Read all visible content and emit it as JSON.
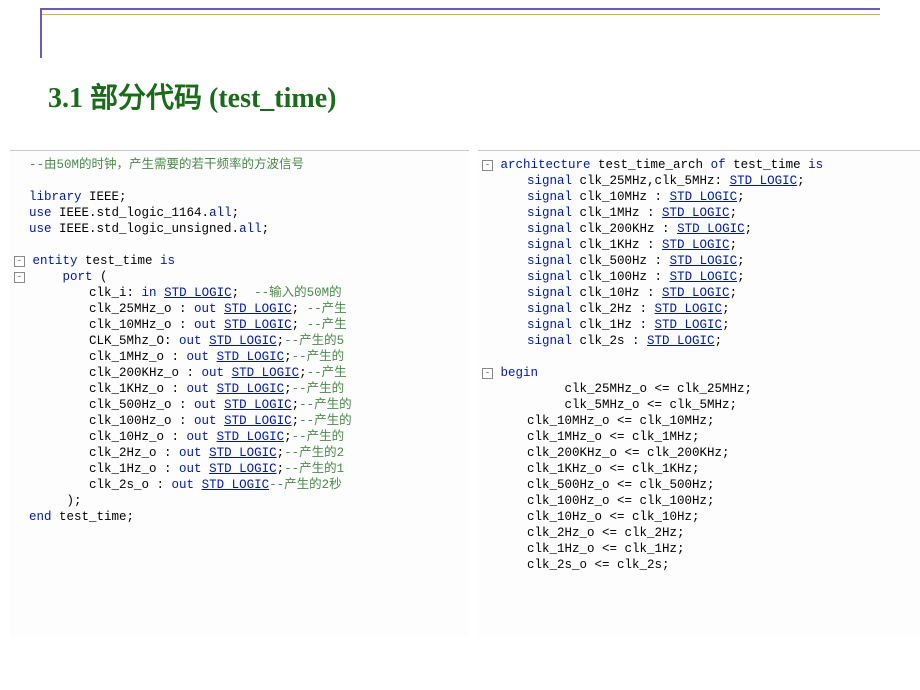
{
  "title": "3.1 部分代码  (test_time)",
  "left": {
    "l1": "--由50M的时钟，产生需要的若干频率的方波信号",
    "l2": "library",
    "l2b": " IEEE;",
    "l3": "use",
    "l3b": " IEEE.std_logic_1164.",
    "l3c": "all",
    "l3d": ";",
    "l4": "use",
    "l4b": " IEEE.std_logic_unsigned.",
    "l4c": "all",
    "l4d": ";",
    "l5a": "entity",
    "l5b": " test_time ",
    "l5c": "is",
    "l6a": "port",
    "l6b": " (",
    "p1a": "clk_i: ",
    "p1b": "in",
    "p1c": " ",
    "p1t": "STD_LOGIC",
    "p1e": ";  ",
    "p1cm": "--输入的50M的",
    "p2a": "clk_25MHz_o : ",
    "p2b": "out",
    "p2c": " ",
    "p2t": "STD_LOGIC",
    "p2e": "; ",
    "p2cm": "--产生",
    "p3a": "clk_10MHz_o : ",
    "p3b": "out",
    "p3c": " ",
    "p3t": "STD_LOGIC",
    "p3e": "; ",
    "p3cm": "--产生",
    "p4a": "CLK_5Mhz_O: ",
    "p4b": "out",
    "p4c": " ",
    "p4t": "STD_LOGIC",
    "p4e": ";",
    "p4cm": "--产生的5",
    "p5a": "clk_1MHz_o : ",
    "p5b": "out",
    "p5c": " ",
    "p5t": "STD_LOGIC",
    "p5e": ";",
    "p5cm": "--产生的",
    "p6a": "clk_200KHz_o : ",
    "p6b": "out",
    "p6c": " ",
    "p6t": "STD_LOGIC",
    "p6e": ";",
    "p6cm": "--产生",
    "p7a": "clk_1KHz_o : ",
    "p7b": "out",
    "p7c": " ",
    "p7t": "STD_LOGIC",
    "p7e": ";",
    "p7cm": "--产生的",
    "p8a": "clk_500Hz_o : ",
    "p8b": "out",
    "p8c": " ",
    "p8t": "STD_LOGIC",
    "p8e": ";",
    "p8cm": "--产生的",
    "p9a": "clk_100Hz_o : ",
    "p9b": "out",
    "p9c": " ",
    "p9t": "STD_LOGIC",
    "p9e": ";",
    "p9cm": "--产生的",
    "p10a": "clk_10Hz_o : ",
    "p10b": "out",
    "p10c": " ",
    "p10t": "STD_LOGIC",
    "p10e": ";",
    "p10cm": "--产生的",
    "p11a": "clk_2Hz_o : ",
    "p11b": "out",
    "p11c": " ",
    "p11t": "STD_LOGIC",
    "p11e": ";",
    "p11cm": "--产生的2",
    "p12a": "clk_1Hz_o : ",
    "p12b": "out",
    "p12c": " ",
    "p12t": "STD_LOGIC",
    "p12e": ";",
    "p12cm": "--产生的1",
    "p13a": "clk_2s_o : ",
    "p13b": "out",
    "p13c": " ",
    "p13t": "STD_LOGIC",
    "p13cm": "--产生的2秒",
    "close": ");",
    "enda": "end",
    "endb": " test_time;"
  },
  "right": {
    "a1a": "architecture",
    "a1b": " test_time_arch ",
    "a1c": "of",
    "a1d": " test_time ",
    "a1e": "is",
    "s1a": "signal",
    "s1b": " clk_25MHz,clk_5MHz: ",
    "s1t": "STD_LOGIC",
    "s1e": ";",
    "s2a": "signal",
    "s2b": " clk_10MHz : ",
    "s2t": "STD_LOGIC",
    "s2e": ";",
    "s3a": "signal",
    "s3b": " clk_1MHz : ",
    "s3t": "STD_LOGIC",
    "s3e": ";",
    "s4a": "signal",
    "s4b": " clk_200KHz : ",
    "s4t": "STD_LOGIC",
    "s4e": ";",
    "s5a": "signal",
    "s5b": " clk_1KHz : ",
    "s5t": "STD_LOGIC",
    "s5e": ";",
    "s6a": "signal",
    "s6b": " clk_500Hz : ",
    "s6t": "STD_LOGIC",
    "s6e": ";",
    "s7a": "signal",
    "s7b": " clk_100Hz : ",
    "s7t": "STD_LOGIC",
    "s7e": ";",
    "s8a": "signal",
    "s8b": " clk_10Hz : ",
    "s8t": "STD_LOGIC",
    "s8e": ";",
    "s9a": "signal",
    "s9b": " clk_2Hz : ",
    "s9t": "STD_LOGIC",
    "s9e": ";",
    "s10a": "signal",
    "s10b": " clk_1Hz : ",
    "s10t": "STD_LOGIC",
    "s10e": ";",
    "s11a": "signal",
    "s11b": " clk_2s : ",
    "s11t": "STD_LOGIC",
    "s11e": ";",
    "begin": "begin",
    "b1": "clk_25MHz_o <= clk_25MHz;",
    "b2": "clk_5MHz_o <= clk_5MHz;",
    "b3": "clk_10MHz_o <= clk_10MHz;",
    "b4": "clk_1MHz_o <= clk_1MHz;",
    "b5": "clk_200KHz_o <= clk_200KHz;",
    "b6": "clk_1KHz_o <= clk_1KHz;",
    "b7": "clk_500Hz_o <= clk_500Hz;",
    "b8": "clk_100Hz_o <= clk_100Hz;",
    "b9": "clk_10Hz_o <= clk_10Hz;",
    "b10": "clk_2Hz_o <= clk_2Hz;",
    "b11": "clk_1Hz_o <= clk_1Hz;",
    "b12": "clk_2s_o <= clk_2s;"
  }
}
